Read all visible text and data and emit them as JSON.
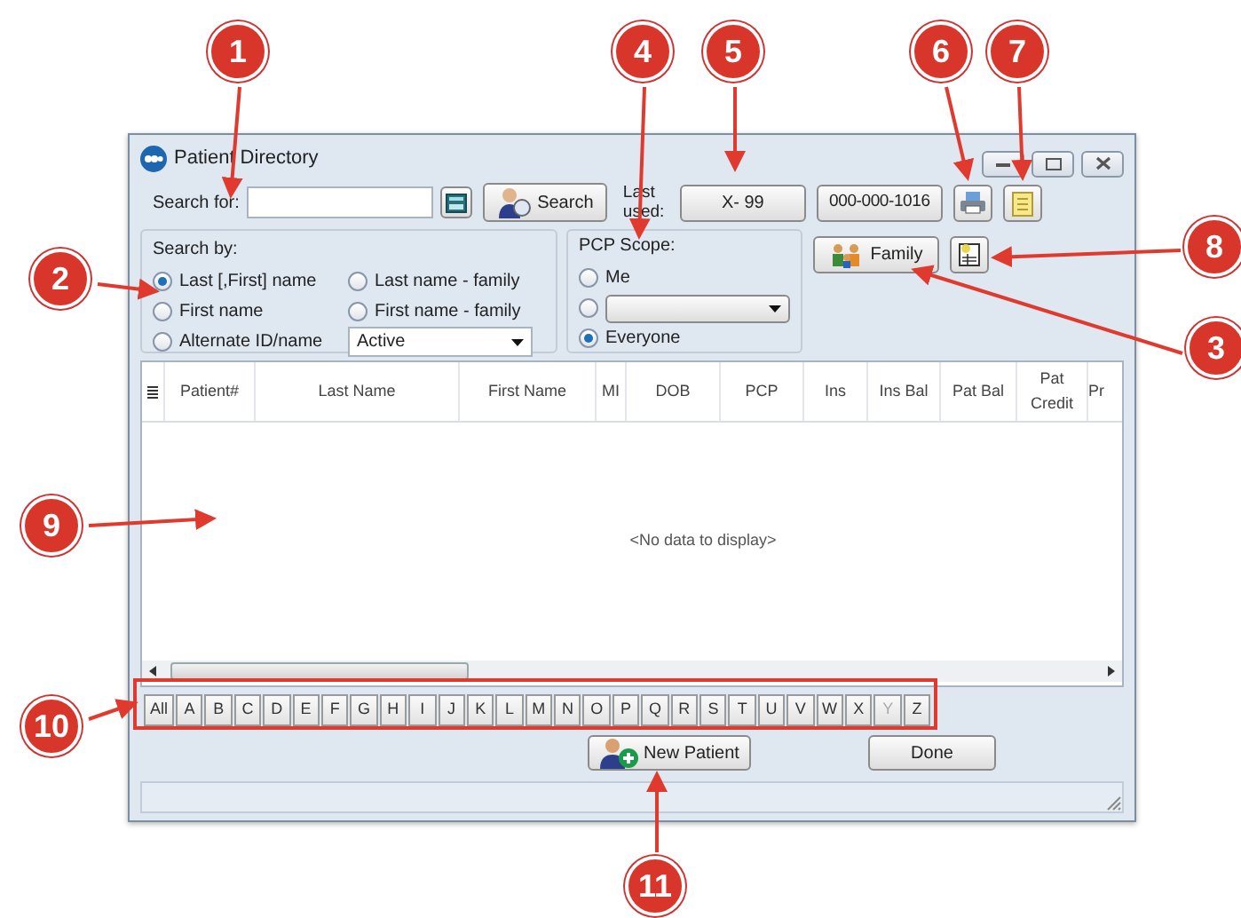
{
  "window": {
    "title": "Patient Directory"
  },
  "search": {
    "label": "Search for:",
    "button": "Search"
  },
  "last_used": {
    "label": "Last used:",
    "button": "X- 99"
  },
  "account_button": "000-000-1016",
  "search_by": {
    "title": "Search by:",
    "options": [
      {
        "label": "Last [,First] name",
        "selected": true
      },
      {
        "label": "Last name - family",
        "selected": false
      },
      {
        "label": "First name",
        "selected": false
      },
      {
        "label": "First name - family",
        "selected": false
      },
      {
        "label": "Alternate ID/name",
        "selected": false
      }
    ],
    "status_dropdown": "Active"
  },
  "pcp_scope": {
    "title": "PCP Scope:",
    "options": [
      {
        "kind": "text",
        "label": "Me",
        "selected": false
      },
      {
        "kind": "dropdown",
        "selected": false
      },
      {
        "kind": "text",
        "label": "Everyone",
        "selected": true
      }
    ]
  },
  "family_button": "Family",
  "table": {
    "columns": [
      "Patient#",
      "Last Name",
      "First Name",
      "MI",
      "DOB",
      "PCP",
      "Ins",
      "Ins Bal",
      "Pat Bal",
      "Pat Credit",
      "Pr"
    ],
    "empty_message": "<No data to display>"
  },
  "alphabet": [
    {
      "label": "All",
      "disabled": false
    },
    {
      "label": "A",
      "disabled": false
    },
    {
      "label": "B",
      "disabled": false
    },
    {
      "label": "C",
      "disabled": false
    },
    {
      "label": "D",
      "disabled": false
    },
    {
      "label": "E",
      "disabled": false
    },
    {
      "label": "F",
      "disabled": false
    },
    {
      "label": "G",
      "disabled": false
    },
    {
      "label": "H",
      "disabled": false
    },
    {
      "label": "I",
      "disabled": false
    },
    {
      "label": "J",
      "disabled": false
    },
    {
      "label": "K",
      "disabled": false
    },
    {
      "label": "L",
      "disabled": false
    },
    {
      "label": "M",
      "disabled": false
    },
    {
      "label": "N",
      "disabled": false
    },
    {
      "label": "O",
      "disabled": false
    },
    {
      "label": "P",
      "disabled": false
    },
    {
      "label": "Q",
      "disabled": false
    },
    {
      "label": "R",
      "disabled": false
    },
    {
      "label": "S",
      "disabled": false
    },
    {
      "label": "T",
      "disabled": false
    },
    {
      "label": "U",
      "disabled": false
    },
    {
      "label": "V",
      "disabled": false
    },
    {
      "label": "W",
      "disabled": false
    },
    {
      "label": "X",
      "disabled": false
    },
    {
      "label": "Y",
      "disabled": true
    },
    {
      "label": "Z",
      "disabled": false
    }
  ],
  "buttons": {
    "new_patient": "New Patient",
    "done": "Done"
  },
  "callouts": [
    "1",
    "2",
    "3",
    "4",
    "5",
    "6",
    "7",
    "8",
    "9",
    "10",
    "11"
  ]
}
